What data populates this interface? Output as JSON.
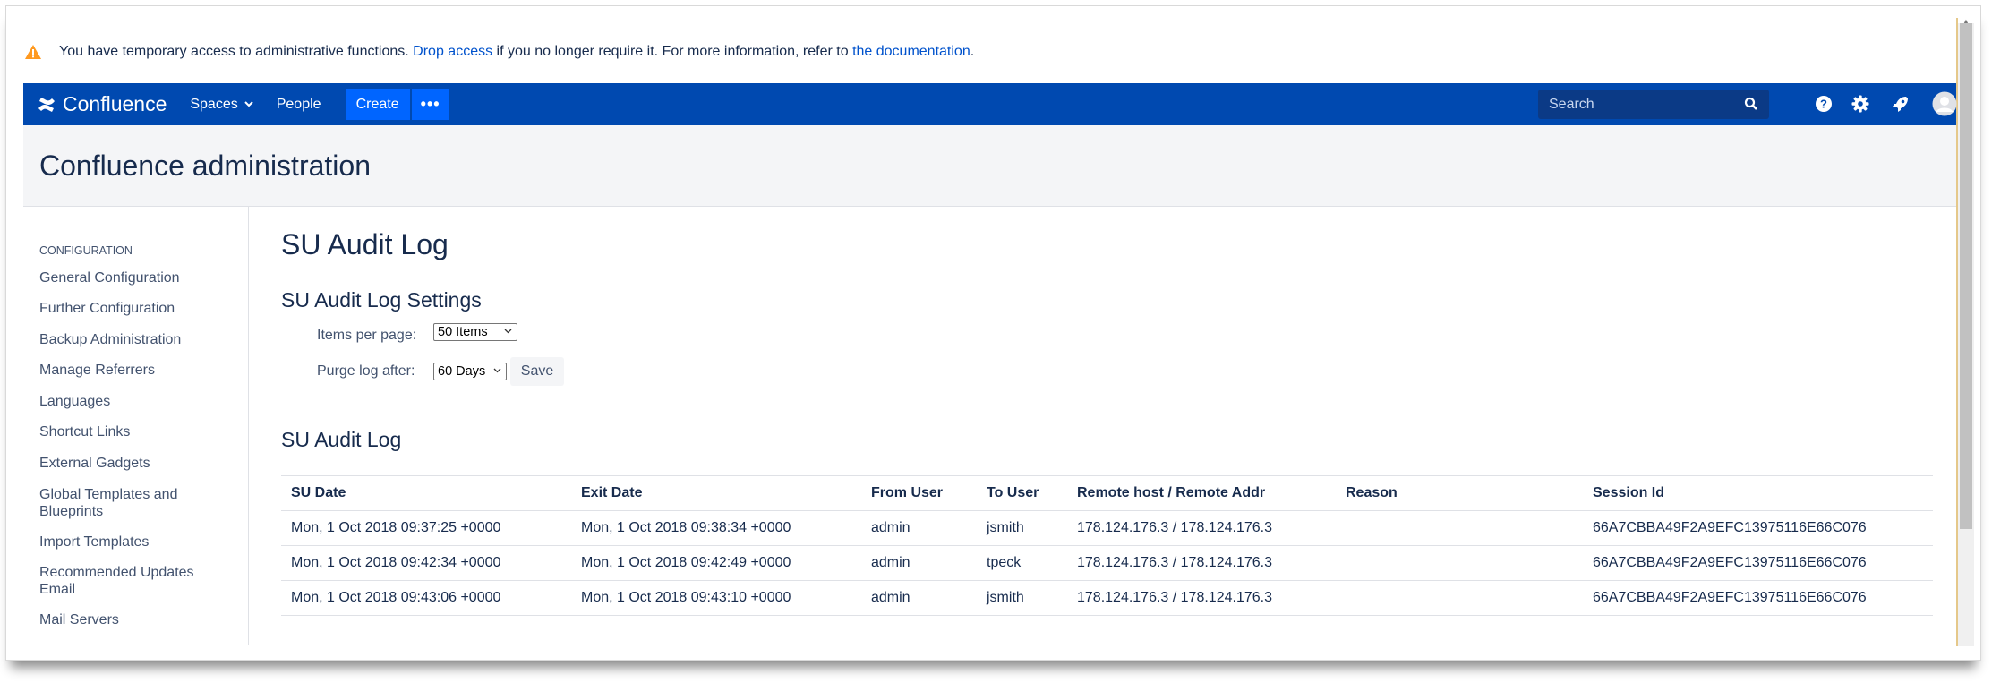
{
  "banner": {
    "text_before": "You have temporary access to administrative functions.",
    "drop_access_link": "Drop access",
    "text_middle": "if you no longer require it. For more information, refer to",
    "documentation_link": "the documentation",
    "text_end": "."
  },
  "nav": {
    "brand": "Confluence",
    "spaces": "Spaces",
    "people": "People",
    "create": "Create",
    "more": "•••",
    "search_placeholder": "Search"
  },
  "admin": {
    "title": "Confluence administration"
  },
  "sidebar": {
    "heading": "CONFIGURATION",
    "items": [
      {
        "label": "General Configuration"
      },
      {
        "label": "Further Configuration"
      },
      {
        "label": "Backup Administration"
      },
      {
        "label": "Manage Referrers"
      },
      {
        "label": "Languages"
      },
      {
        "label": "Shortcut Links"
      },
      {
        "label": "External Gadgets"
      },
      {
        "label": "Global Templates and Blueprints"
      },
      {
        "label": "Import Templates"
      },
      {
        "label": "Recommended Updates Email"
      },
      {
        "label": "Mail Servers"
      }
    ]
  },
  "main": {
    "page_title": "SU Audit Log",
    "settings_title": "SU Audit Log Settings",
    "items_per_page_label": "Items per page:",
    "items_per_page_value": "50 Items",
    "purge_label": "Purge log after:",
    "purge_value": "60 Days",
    "save_label": "Save",
    "log_title": "SU Audit Log"
  },
  "table": {
    "headers": {
      "su_date": "SU Date",
      "exit_date": "Exit Date",
      "from_user": "From User",
      "to_user": "To User",
      "remote": "Remote host / Remote Addr",
      "reason": "Reason",
      "session": "Session Id"
    },
    "rows": [
      {
        "su_date": "Mon, 1 Oct 2018 09:37:25 +0000",
        "exit_date": "Mon, 1 Oct 2018 09:38:34 +0000",
        "from_user": "admin",
        "to_user": "jsmith",
        "remote": "178.124.176.3 / 178.124.176.3",
        "reason": "",
        "session": "66A7CBBA49F2A9EFC13975116E66C076"
      },
      {
        "su_date": "Mon, 1 Oct 2018 09:42:34 +0000",
        "exit_date": "Mon, 1 Oct 2018 09:42:49 +0000",
        "from_user": "admin",
        "to_user": "tpeck",
        "remote": "178.124.176.3 / 178.124.176.3",
        "reason": "",
        "session": "66A7CBBA49F2A9EFC13975116E66C076"
      },
      {
        "su_date": "Mon, 1 Oct 2018 09:43:06 +0000",
        "exit_date": "Mon, 1 Oct 2018 09:43:10 +0000",
        "from_user": "admin",
        "to_user": "jsmith",
        "remote": "178.124.176.3 / 178.124.176.3",
        "reason": "",
        "session": "66A7CBBA49F2A9EFC13975116E66C076"
      }
    ]
  },
  "colors": {
    "nav_bg": "#0049b0",
    "create_bg": "#0065ff",
    "link": "#0052cc",
    "warning": "#ff991f"
  }
}
